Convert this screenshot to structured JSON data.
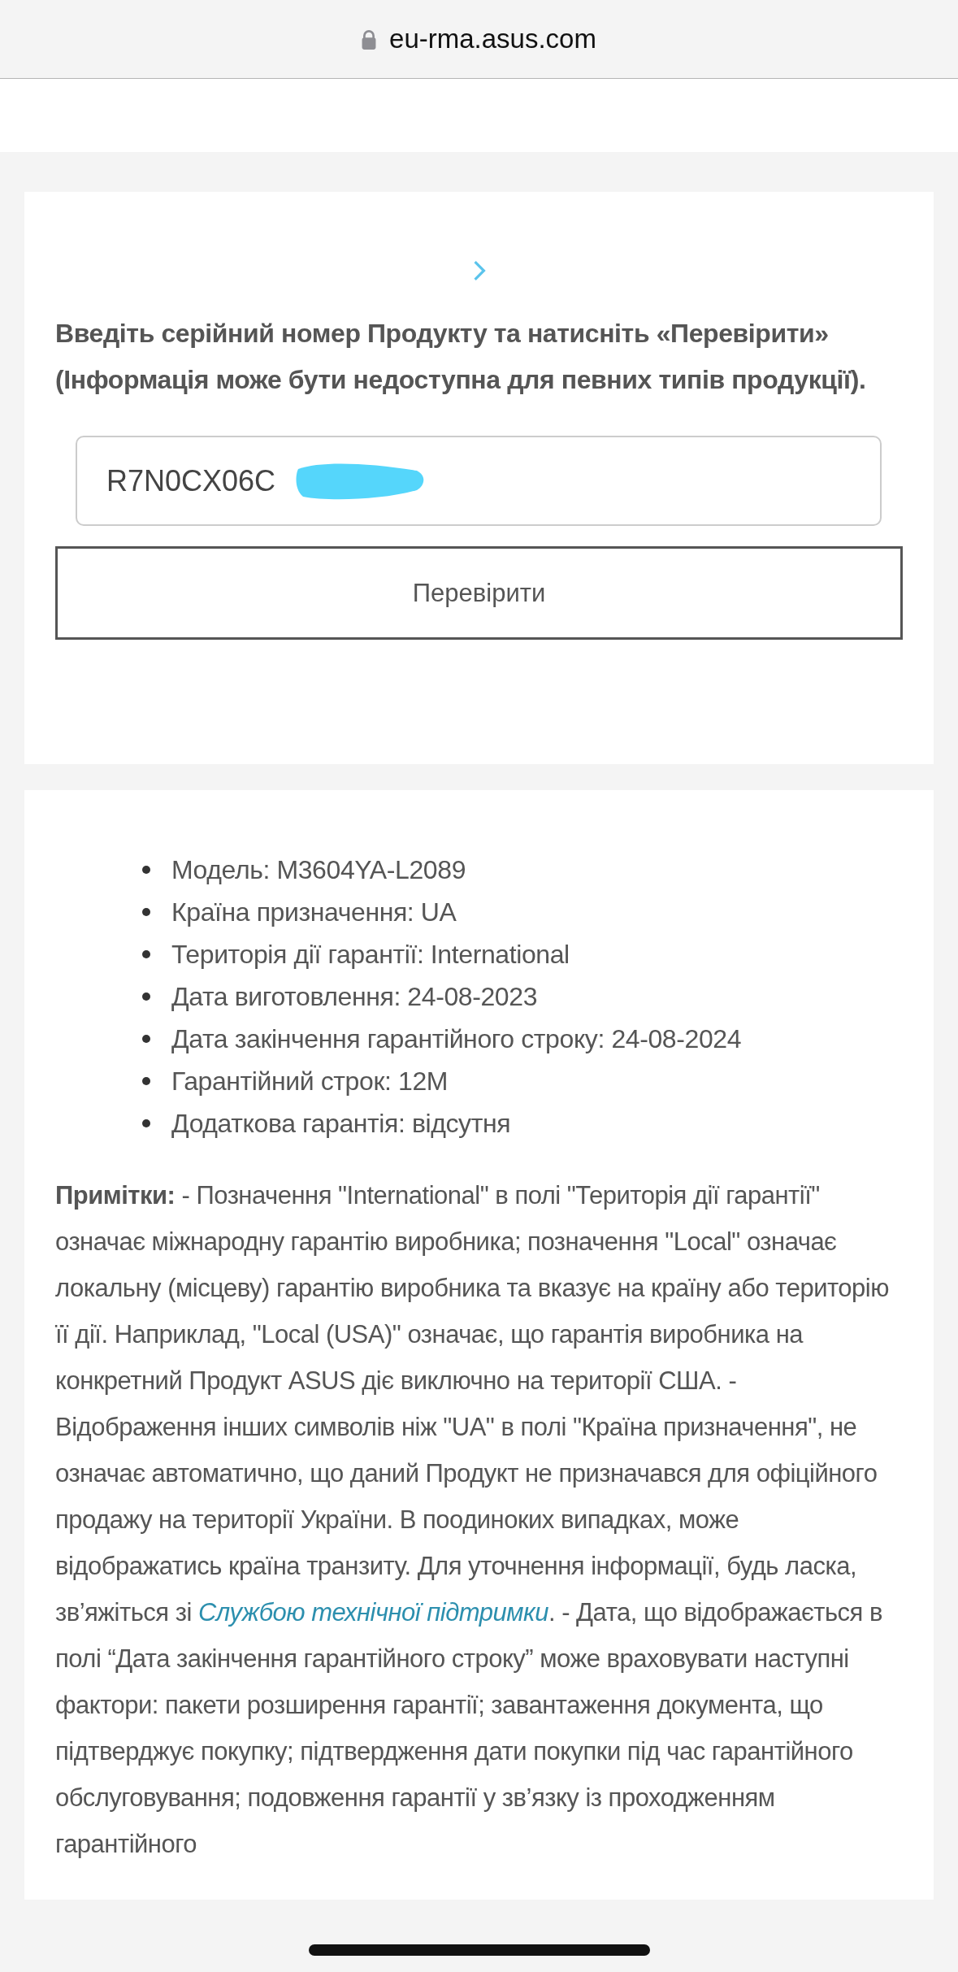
{
  "address_bar": {
    "url": "eu-rma.asus.com"
  },
  "serial_check": {
    "instruction": "Введіть серійний номер Продукту та натисніть «Перевірити» (Інформація може бути недоступна для певних типів продукції).",
    "serial_value": "R7N0CX06C",
    "button": "Перевірити"
  },
  "product_info": [
    "Модель: M3604YA-L2089",
    "Країна призначення: UA",
    "Територія дії гарантії: International",
    "Дата виготовлення: 24-08-2023",
    "Дата закінчення гарантійного строку: 24-08-2024",
    "Гарантійний строк: 12M",
    "Додаткова гарантія: відсутня"
  ],
  "notes": {
    "text_before": "**Примітки:** - Позначення \"International\" в полі \"Територія дії гарантії\" означає міжнародну гарантію виробника; позначення \"Local\" означає локальну (місцеву) гарантію виробника та вказує на країну або територію її дії. Наприклад, \"Local (USA)\" означає, що гарантія виробника на конкретний Продукт ASUS діє виключно на території США. - Відображення інших символів ніж \"UA\" в полі \"Країна призначення\", не означає автоматично, що даний Продукт не призначався для офіційного продажу на території України. В поодиноких випадках, може відображатись країна транзиту. Для уточнення інформації, будь ласка, зв’яжіться зі",
    "link": "Службою технічної підтримки",
    "text_after": ". - Дата, що відображається в полі “Дата закінчення гарантійного строку” може враховувати наступні фактори: пакети розширення гарантії; завантаження документа, що підтверджує покупку; підтвердження дати покупки під час гарантійного обслуговування; подовження гарантії у зв’язку із проходженням гарантійного"
  }
}
